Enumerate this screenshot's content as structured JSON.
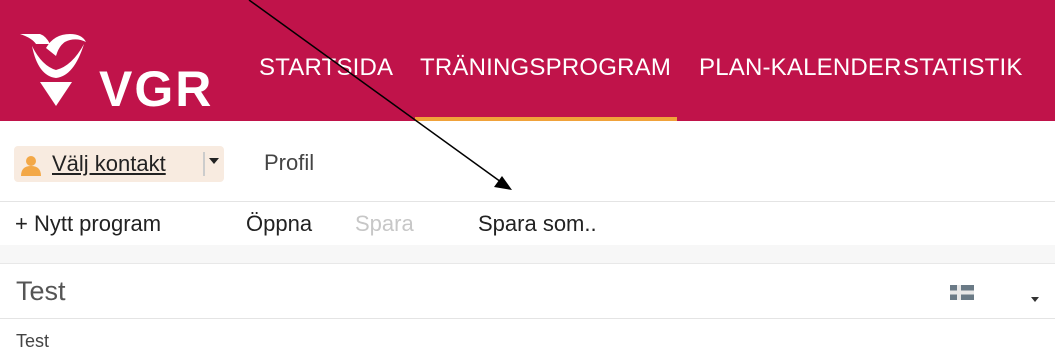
{
  "brand": {
    "logo_text": "VGR",
    "colors": {
      "nav_background": "#c0134a",
      "nav_active_underline": "#f0a23a",
      "contact_pill": "#f8ebe0",
      "person_icon": "#f3a847"
    }
  },
  "nav": {
    "items": [
      {
        "label": "STARTSIDA"
      },
      {
        "label": "TRÄNINGSPROGRAM",
        "active": true
      },
      {
        "label": "PLAN-KALENDER"
      },
      {
        "label": "STATISTIK"
      }
    ]
  },
  "contact": {
    "label": "Välj kontakt",
    "icon": "person-icon",
    "dropdown_icon": "caret-down-icon"
  },
  "profile": {
    "label": "Profil"
  },
  "toolbar": {
    "new_program": "+ Nytt program",
    "open": "Öppna",
    "save": "Spara",
    "save_disabled": true,
    "save_as": "Spara som.."
  },
  "program": {
    "title": "Test",
    "subtitle": "Test",
    "language_icon": "flag-icon",
    "menu_icon": "caret-down-icon"
  }
}
